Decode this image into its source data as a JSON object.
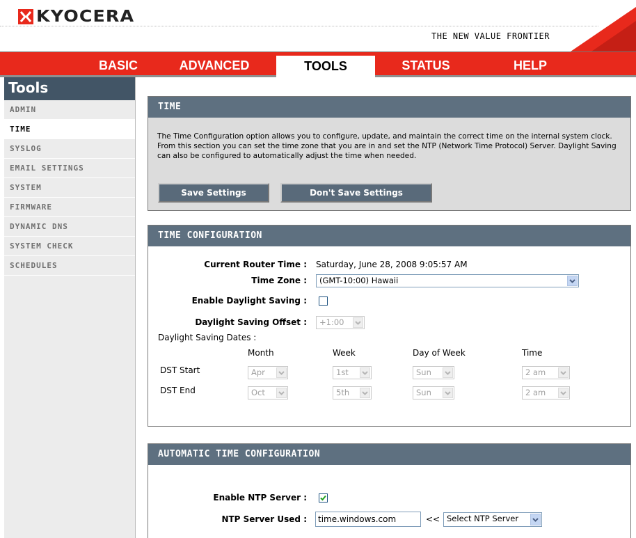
{
  "header": {
    "logo_text": "KYOCERA",
    "tagline": "THE NEW VALUE FRONTIER"
  },
  "nav": {
    "tabs": [
      "BASIC",
      "ADVANCED",
      "TOOLS",
      "STATUS",
      "HELP"
    ],
    "active": "TOOLS"
  },
  "sidebar": {
    "title": "Tools",
    "items": [
      "ADMIN",
      "TIME",
      "SYSLOG",
      "EMAIL SETTINGS",
      "SYSTEM",
      "FIRMWARE",
      "DYNAMIC DNS",
      "SYSTEM CHECK",
      "SCHEDULES"
    ],
    "active": "TIME"
  },
  "time_section": {
    "title": "TIME",
    "description": "The Time Configuration option allows you to configure, update, and maintain the correct time on the internal system clock. From this section you can set the time zone that you are in and set the NTP (Network Time Protocol) Server. Daylight Saving can also be configured to automatically adjust the time when needed.",
    "save_label": "Save Settings",
    "dont_save_label": "Don't Save Settings"
  },
  "config": {
    "title": "TIME CONFIGURATION",
    "current_time_label": "Current Router Time :",
    "current_time_value": "Saturday, June 28, 2008 9:05:57 AM",
    "timezone_label": "Time Zone :",
    "timezone_value": "(GMT-10:00) Hawaii",
    "daylight_label": "Enable Daylight Saving :",
    "daylight_checked": false,
    "offset_label": "Daylight Saving Offset :",
    "offset_value": "+1:00",
    "dates_label": "Daylight Saving Dates :",
    "columns": [
      "Month",
      "Week",
      "Day of Week",
      "Time"
    ],
    "dst_start": {
      "label": "DST Start",
      "month": "Apr",
      "week": "1st",
      "day": "Sun",
      "time": "2 am"
    },
    "dst_end": {
      "label": "DST End",
      "month": "Oct",
      "week": "5th",
      "day": "Sun",
      "time": "2 am"
    }
  },
  "auto": {
    "title": "AUTOMATIC TIME CONFIGURATION",
    "ntp_enable_label": "Enable NTP Server :",
    "ntp_enabled": true,
    "ntp_server_label": "NTP Server Used :",
    "ntp_server_value": "time.windows.com",
    "arrows": "<<",
    "ntp_select_value": "Select NTP Server"
  },
  "colors": {
    "nav_red": "#e8291c",
    "section_header": "#5e7080",
    "sidebar_title": "#425566",
    "button": "#596a7a"
  },
  "icons": {
    "logo_mark": "kyocera-logo-icon",
    "dropdown_arrow": "chevron-down-icon",
    "checkmark": "checkmark-icon"
  }
}
